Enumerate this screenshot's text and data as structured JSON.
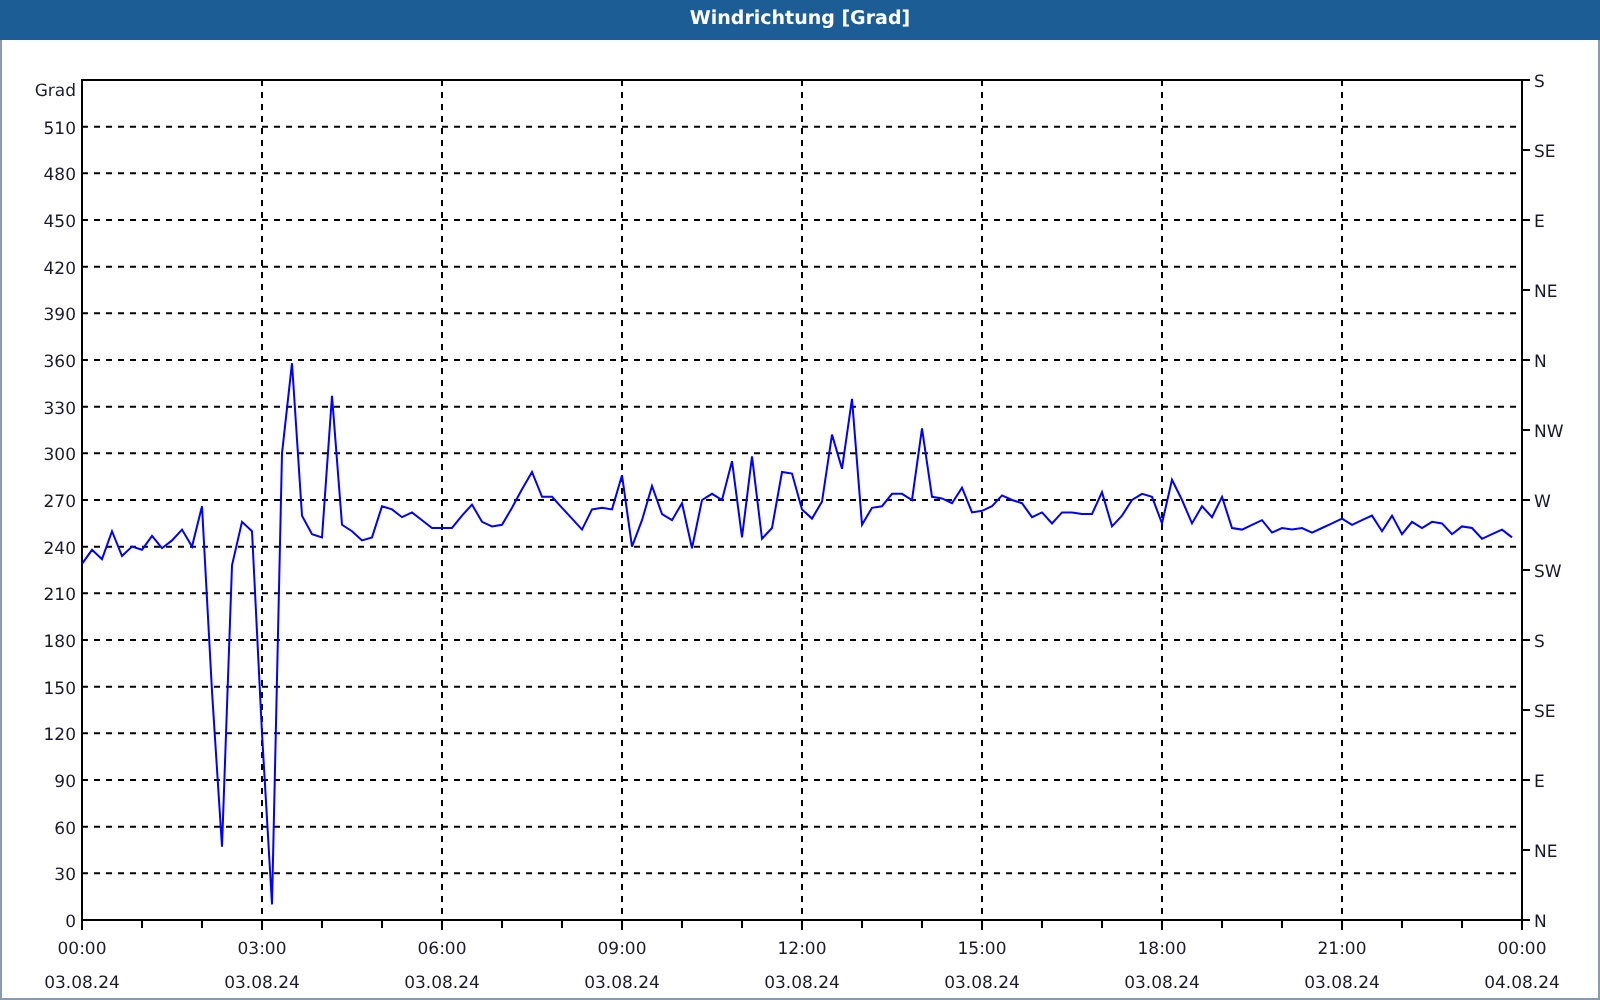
{
  "window": {
    "title": "Windrichtung [Grad]"
  },
  "chart": {
    "right_axis_labels": [
      "S",
      "SE",
      "E",
      "NE",
      "N",
      "NW",
      "W",
      "SW",
      "S",
      "SE",
      "E",
      "NE",
      "N"
    ],
    "chart_data": {
      "type": "line",
      "grid": true,
      "ylabel": "Grad",
      "ylim": [
        0,
        540
      ],
      "yticks": [
        0,
        30,
        60,
        90,
        120,
        150,
        180,
        210,
        240,
        270,
        300,
        330,
        360,
        390,
        420,
        450,
        480,
        510
      ],
      "categories": [
        "00:00\n03.08.24",
        null,
        null,
        null,
        null,
        null,
        null,
        null,
        null,
        null,
        null,
        null,
        null,
        null,
        null,
        null,
        null,
        null,
        "03:00\n03.08.24",
        null,
        null,
        null,
        null,
        null,
        null,
        null,
        null,
        null,
        null,
        null,
        null,
        null,
        null,
        null,
        null,
        null,
        "06:00\n03.08.24",
        null,
        null,
        null,
        null,
        null,
        null,
        null,
        null,
        null,
        null,
        null,
        null,
        null,
        null,
        null,
        null,
        null,
        "09:00\n03.08.24",
        null,
        null,
        null,
        null,
        null,
        null,
        null,
        null,
        null,
        null,
        null,
        null,
        null,
        null,
        null,
        null,
        null,
        "12:00\n03.08.24",
        null,
        null,
        null,
        null,
        null,
        null,
        null,
        null,
        null,
        null,
        null,
        null,
        null,
        null,
        null,
        null,
        null,
        "15:00\n03.08.24",
        null,
        null,
        null,
        null,
        null,
        null,
        null,
        null,
        null,
        null,
        null,
        null,
        null,
        null,
        null,
        null,
        null,
        "18:00\n03.08.24",
        null,
        null,
        null,
        null,
        null,
        null,
        null,
        null,
        null,
        null,
        null,
        null,
        null,
        null,
        null,
        null,
        null,
        "21:00\n03.08.24",
        null,
        null,
        null,
        null,
        null,
        null,
        null,
        null,
        null,
        null,
        null,
        null,
        null,
        null,
        null,
        null,
        null,
        "00:00\n04.08.24"
      ],
      "series": [
        {
          "color": "#0000ff",
          "values": [
            229,
            238,
            232,
            250,
            234,
            240,
            238,
            247,
            239,
            244,
            251,
            240,
            266,
            147,
            47,
            228,
            256,
            250,
            120,
            10,
            300,
            358,
            260,
            248,
            246,
            337,
            254,
            250,
            244,
            246,
            266,
            264,
            259,
            262,
            257,
            252,
            252,
            252,
            260,
            267,
            256,
            253,
            254,
            265,
            277,
            288,
            272,
            272,
            265,
            258,
            251,
            264,
            265,
            264,
            286,
            240,
            257,
            279,
            261,
            257,
            268,
            239,
            270,
            274,
            270,
            295,
            246,
            298,
            245,
            252,
            288,
            287,
            264,
            258,
            269,
            312,
            290,
            335,
            254,
            265,
            266,
            274,
            274,
            270,
            316,
            272,
            271,
            268,
            278,
            262,
            263,
            266,
            273,
            270,
            268,
            259,
            262,
            255,
            262,
            262,
            261,
            261,
            275,
            253,
            260,
            270,
            274,
            272,
            255,
            283,
            270,
            255,
            266,
            259,
            272,
            252,
            251,
            254,
            257,
            249,
            252,
            251,
            252,
            249,
            252,
            255,
            258,
            254,
            257,
            260,
            250,
            260,
            248,
            256,
            252,
            256,
            255,
            248,
            253,
            252,
            245,
            248,
            251,
            246,
            null
          ]
        }
      ]
    }
  }
}
